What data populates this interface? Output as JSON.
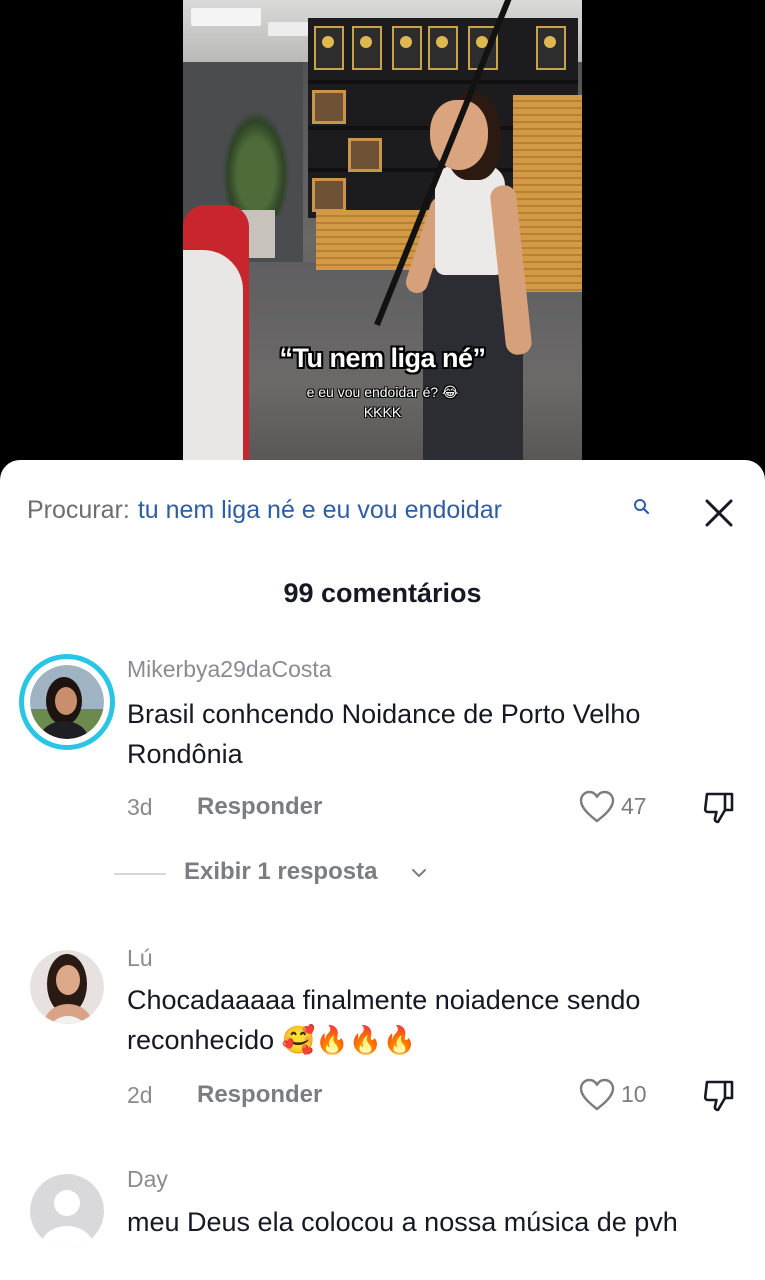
{
  "video": {
    "caption_main": "“Tu nem liga né”",
    "caption_sub": "e eu vou endoidar é? 😂",
    "caption_laugh": "KKKK"
  },
  "search": {
    "prefix": "Procurar:",
    "query": "tu nem liga né e eu vou endoidar",
    "search_icon": "search-icon",
    "close_icon": "close-icon"
  },
  "comments_count": "99 comentários",
  "comments": [
    {
      "username": "Mikerbya29daCosta",
      "text": "Brasil conhcendo Noidance de Porto Velho Rondônia",
      "time": "3d",
      "reply_label": "Responder",
      "likes": "47",
      "has_story_ring": true,
      "view_replies": "Exibir 1 resposta"
    },
    {
      "username": "Lú",
      "text": "Chocadaaaaa finalmente noiadence sendo reconhecido 🥰🔥🔥🔥",
      "time": "2d",
      "reply_label": "Responder",
      "likes": "10"
    },
    {
      "username": "Day",
      "text": "meu Deus ela colocou a nossa música de pvh"
    }
  ],
  "colors": {
    "link_blue": "#2e5da6",
    "story_ring": "#29c5e6",
    "muted_text": "#8a8b91"
  }
}
